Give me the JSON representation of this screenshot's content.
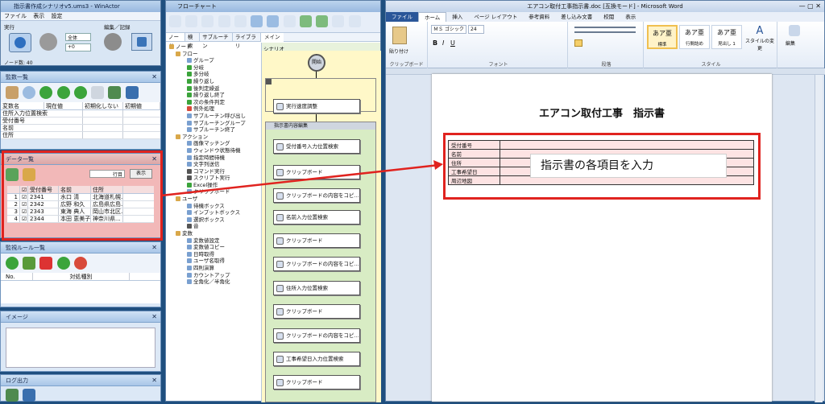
{
  "winactor": {
    "title": "指示書作成シナリオv5.ums3 - WinActor",
    "menu": [
      "ファイル",
      "表示",
      "設定"
    ],
    "run_label": "実行",
    "edit_label": "編集／記録",
    "select_all": "全体",
    "select_num": "+0",
    "node_count": "ノード数: 40"
  },
  "monitor_panel": {
    "title": "監数一覧",
    "columns": [
      "変数名",
      "現在値",
      "初期化しない",
      "初期値"
    ],
    "rows": [
      "住所入力位置検索",
      "受付番号",
      "名前",
      "住所"
    ]
  },
  "data_panel": {
    "title": "データ一覧",
    "row_label": "行目",
    "show_button": "表示",
    "columns": [
      "",
      "受付番号",
      "名前",
      "住所"
    ],
    "rows": [
      {
        "no": "1",
        "id": "2341",
        "name": "水口 清",
        "addr": "北海道札幌..."
      },
      {
        "no": "2",
        "id": "2342",
        "name": "広野 和久",
        "addr": "広島県広島..."
      },
      {
        "no": "3",
        "id": "2343",
        "name": "東海 典人",
        "addr": "岡山市北区..."
      },
      {
        "no": "4",
        "id": "2344",
        "name": "本田 恵美子",
        "addr": "神奈川県..."
      }
    ]
  },
  "rule_panel": {
    "title": "監視ルール一覧",
    "col_no": "No.",
    "col_type": "対処種別"
  },
  "image_panel": {
    "title": "イメージ"
  },
  "log_panel": {
    "title": "ログ出力"
  },
  "flowchart": {
    "title": "フローチャート",
    "tabs": [
      "ノード",
      "検索",
      "サブルーチン",
      "ライブラリ"
    ],
    "main_tab": "メイン",
    "scenario_label": "シナリオ",
    "start_label": "開始",
    "group_label": "指示書内容編集",
    "tree": [
      "ノード",
      "フロー",
      "グループ",
      "分岐",
      "多分岐",
      "繰り返し",
      "後判定繰返",
      "繰り返し終了",
      "次の条件判定",
      "例外処理",
      "サブルーチン呼び出し",
      "サブルーチングループ",
      "サブルーチン終了",
      "アクション",
      "画像マッチング",
      "ウィンドウ状態待機",
      "指定時間待機",
      "文字列送信",
      "コマンド実行",
      "スクリプト実行",
      "Excel操作",
      "クリップボード",
      "ユーザ",
      "待機ボックス",
      "インプットボックス",
      "選択ボックス",
      "音",
      "変数",
      "変数値設定",
      "変数値コピー",
      "日時取得",
      "ユーザ名取得",
      "四則演算",
      "カウントアップ",
      "全角化／半角化"
    ],
    "nodes": [
      "実行速度調整",
      "受付番号入力位置検索",
      "クリップボード",
      "クリップボードの内容をコピ...",
      "名前入力位置検索",
      "クリップボード",
      "クリップボードの内容をコピ...",
      "住所入力位置検索",
      "クリップボード",
      "クリップボードの内容をコピ...",
      "工事希望日入力位置検索",
      "クリップボード"
    ]
  },
  "word": {
    "title": "エアコン取付工事指示書.doc [互換モード] - Microsoft Word",
    "ribbon_tabs": [
      "ファイル",
      "ホーム",
      "挿入",
      "ページ レイアウト",
      "参考資料",
      "差し込み文書",
      "校閲",
      "表示"
    ],
    "paste_label": "貼り付け",
    "clipboard_group": "クリップボード",
    "font_group": "フォント",
    "paragraph_group": "段落",
    "styles_group": "スタイル",
    "edit_group": "編集",
    "font_name": "ＭＳ ゴシック",
    "font_size": "24",
    "styles": [
      {
        "sample": "あア亜",
        "name": "標準"
      },
      {
        "sample": "あア亜",
        "name": "行間詰め"
      },
      {
        "sample": "あア亜",
        "name": "見出し 1"
      }
    ],
    "style_change": "スタイルの変更",
    "doc_title": "エアコン取付工事　指示書",
    "table_rows": [
      "受付番号",
      "名前",
      "住所",
      "工事希望日",
      "周辺地図"
    ],
    "overlay_text": "指示書の各項目を入力"
  },
  "colors": {
    "highlight": "#e0231f",
    "word_blue": "#2a5699"
  }
}
